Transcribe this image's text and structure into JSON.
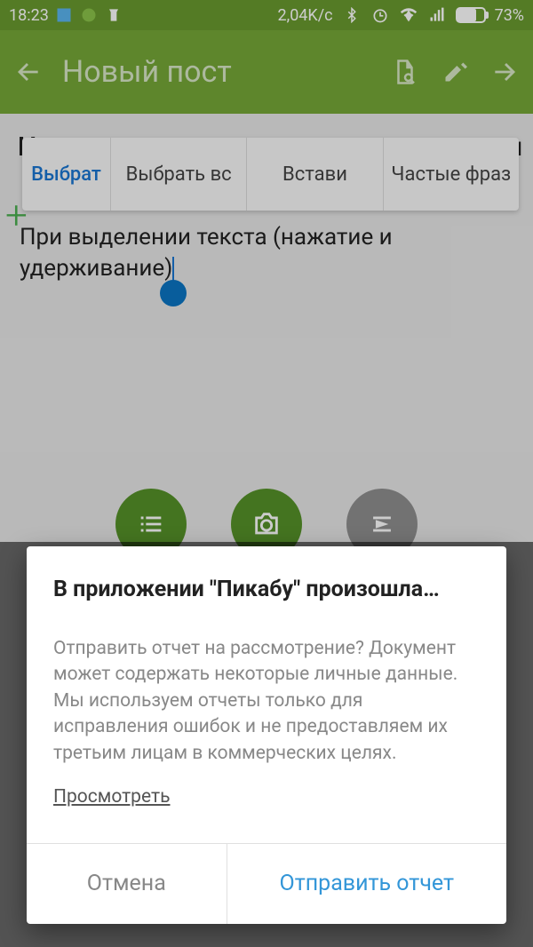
{
  "statusbar": {
    "time": "18:23",
    "data_rate": "2,04K/c",
    "battery_pct": "73%"
  },
  "appbar": {
    "title": "Новый пост"
  },
  "context_menu": {
    "items": [
      "Выбрат",
      "Выбрать вс",
      "Встави",
      "Частые фраз"
    ]
  },
  "editor": {
    "text": "При выделении текста (нажатие и удерживание)"
  },
  "content": {
    "hidden_title": "Н",
    "hidden_title_end": "и"
  },
  "dialog": {
    "title": "В приложении \"Пикабу\" произошла…",
    "body": "Отправить отчет на рассмотрение? Документ может содержать некоторые личные данные. Мы используем отчеты только для исправления ошибок и не предоставляем их третьим лицам в коммерческих целях.",
    "link": "Просмотреть",
    "cancel": "Отмена",
    "confirm": "Отправить отчет"
  }
}
